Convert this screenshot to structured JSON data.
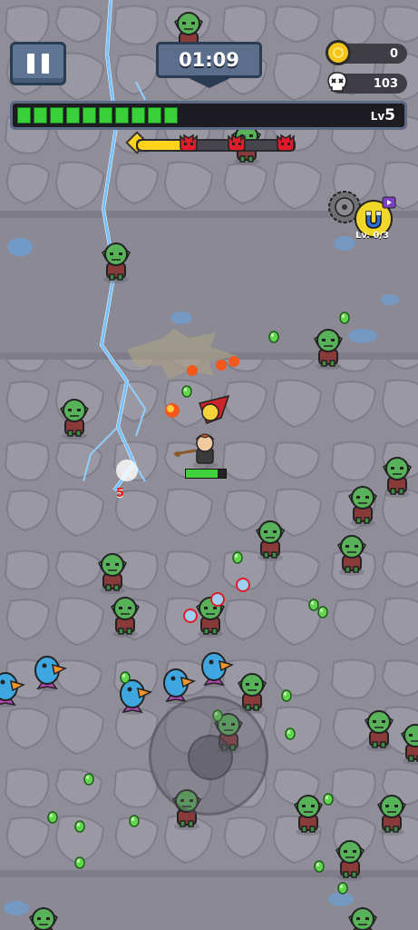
{
  "hud": {
    "timer": "01:09",
    "coins": "0",
    "kills": "103",
    "level_prefix": "Lv",
    "level_number": "5",
    "xp_segments_filled": 10,
    "skill_level_label": "Lv. 0/3",
    "damage_number": "5"
  },
  "icons": [
    "pause-icon",
    "coin-icon",
    "skull-icon",
    "boss-skull-icon",
    "saw-blade-icon",
    "magnet-icon",
    "play-video-icon"
  ],
  "colors": {
    "xp_green": "#3ad03a",
    "boss_progress_yellow": "#ffd21c",
    "boss_marker_red": "#e01c2c",
    "hud_blue": "#5e7693",
    "lightning_blue": "#3aa6ff"
  }
}
